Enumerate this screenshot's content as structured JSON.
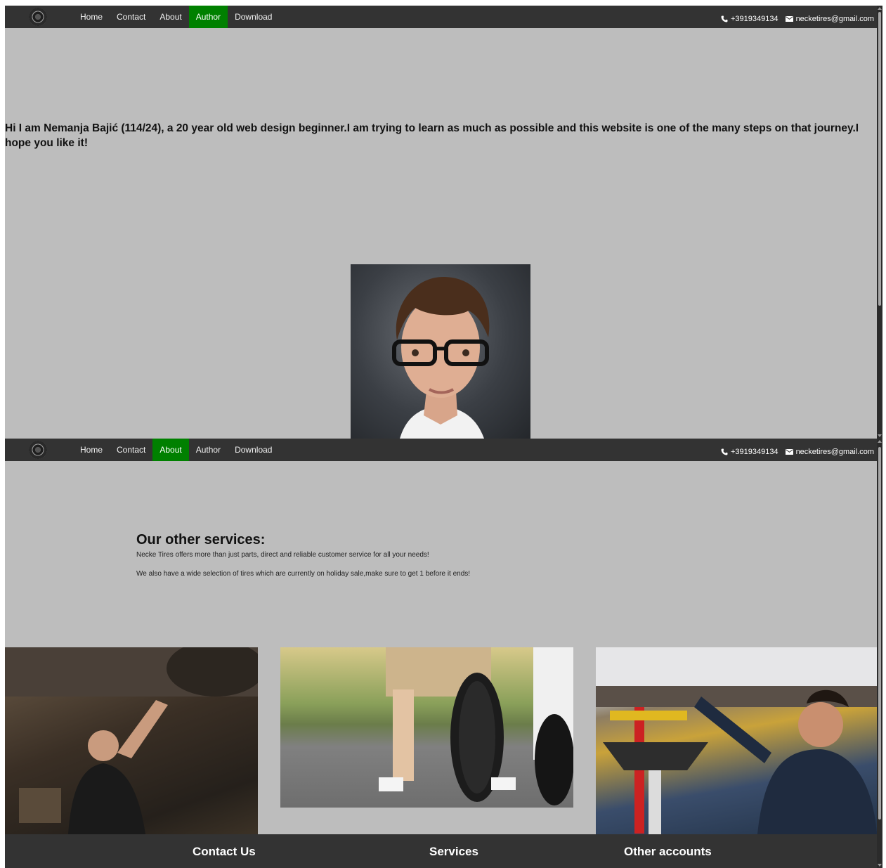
{
  "nav": {
    "items": [
      "Home",
      "Contact",
      "About",
      "Author",
      "Download"
    ],
    "phone": "+3919349134",
    "email": "necketires@gmail.com"
  },
  "author_page": {
    "active_nav": "Author",
    "intro": "Hi I am Nemanja Bajić (114/24), a 20 year old web design beginner.I am trying to learn as much as possible and this website is one of the many steps on that journey.I hope you like it!"
  },
  "about_page": {
    "active_nav": "About",
    "services_heading": "Our other services:",
    "services_p1": "Necke Tires offers more than just parts, direct and reliable customer service for all your needs!",
    "services_p2": "We also have a wide selection of tires which are currently on holiday sale,make sure to get 1 before it ends!",
    "footer": {
      "contact": "Contact Us",
      "services": "Services",
      "accounts": "Other accounts"
    }
  },
  "colors": {
    "navbar": "#333333",
    "active_nav": "#008000",
    "page_bg": "#bdbdbd"
  }
}
